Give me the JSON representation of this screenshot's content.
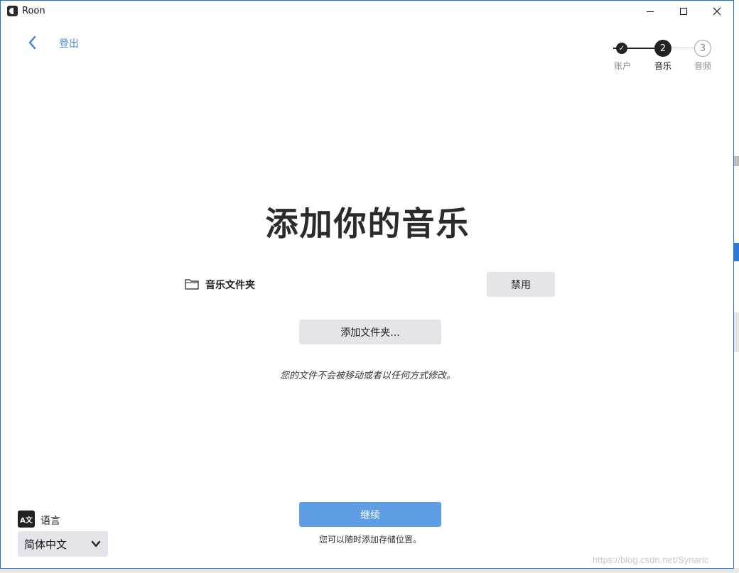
{
  "window": {
    "app_title": "Roon"
  },
  "nav": {
    "logout_label": "登出"
  },
  "stepper": {
    "steps": [
      {
        "label": "账户",
        "marker": "✓",
        "state": "done"
      },
      {
        "label": "音乐",
        "marker": "2",
        "state": "current"
      },
      {
        "label": "音频",
        "marker": "3",
        "state": "upcoming"
      }
    ]
  },
  "main": {
    "title": "添加你的音乐",
    "folder_label": "音乐文件夹",
    "disable_label": "禁用",
    "add_folder_label": "添加文件夹...",
    "note": "您的文件不会被移动或者以任何方式修改。",
    "continue_label": "继续",
    "continue_note": "您可以随时添加存储位置。"
  },
  "language": {
    "label": "语言",
    "icon_text": "A文",
    "selected": "简体中文"
  },
  "watermark": "https://blog.csdn.net/Synaric",
  "colors": {
    "accent": "#5f9ee4",
    "link": "#4a8ad8",
    "button_bg": "#e3e5ea",
    "window_border": "#1b73d1"
  }
}
